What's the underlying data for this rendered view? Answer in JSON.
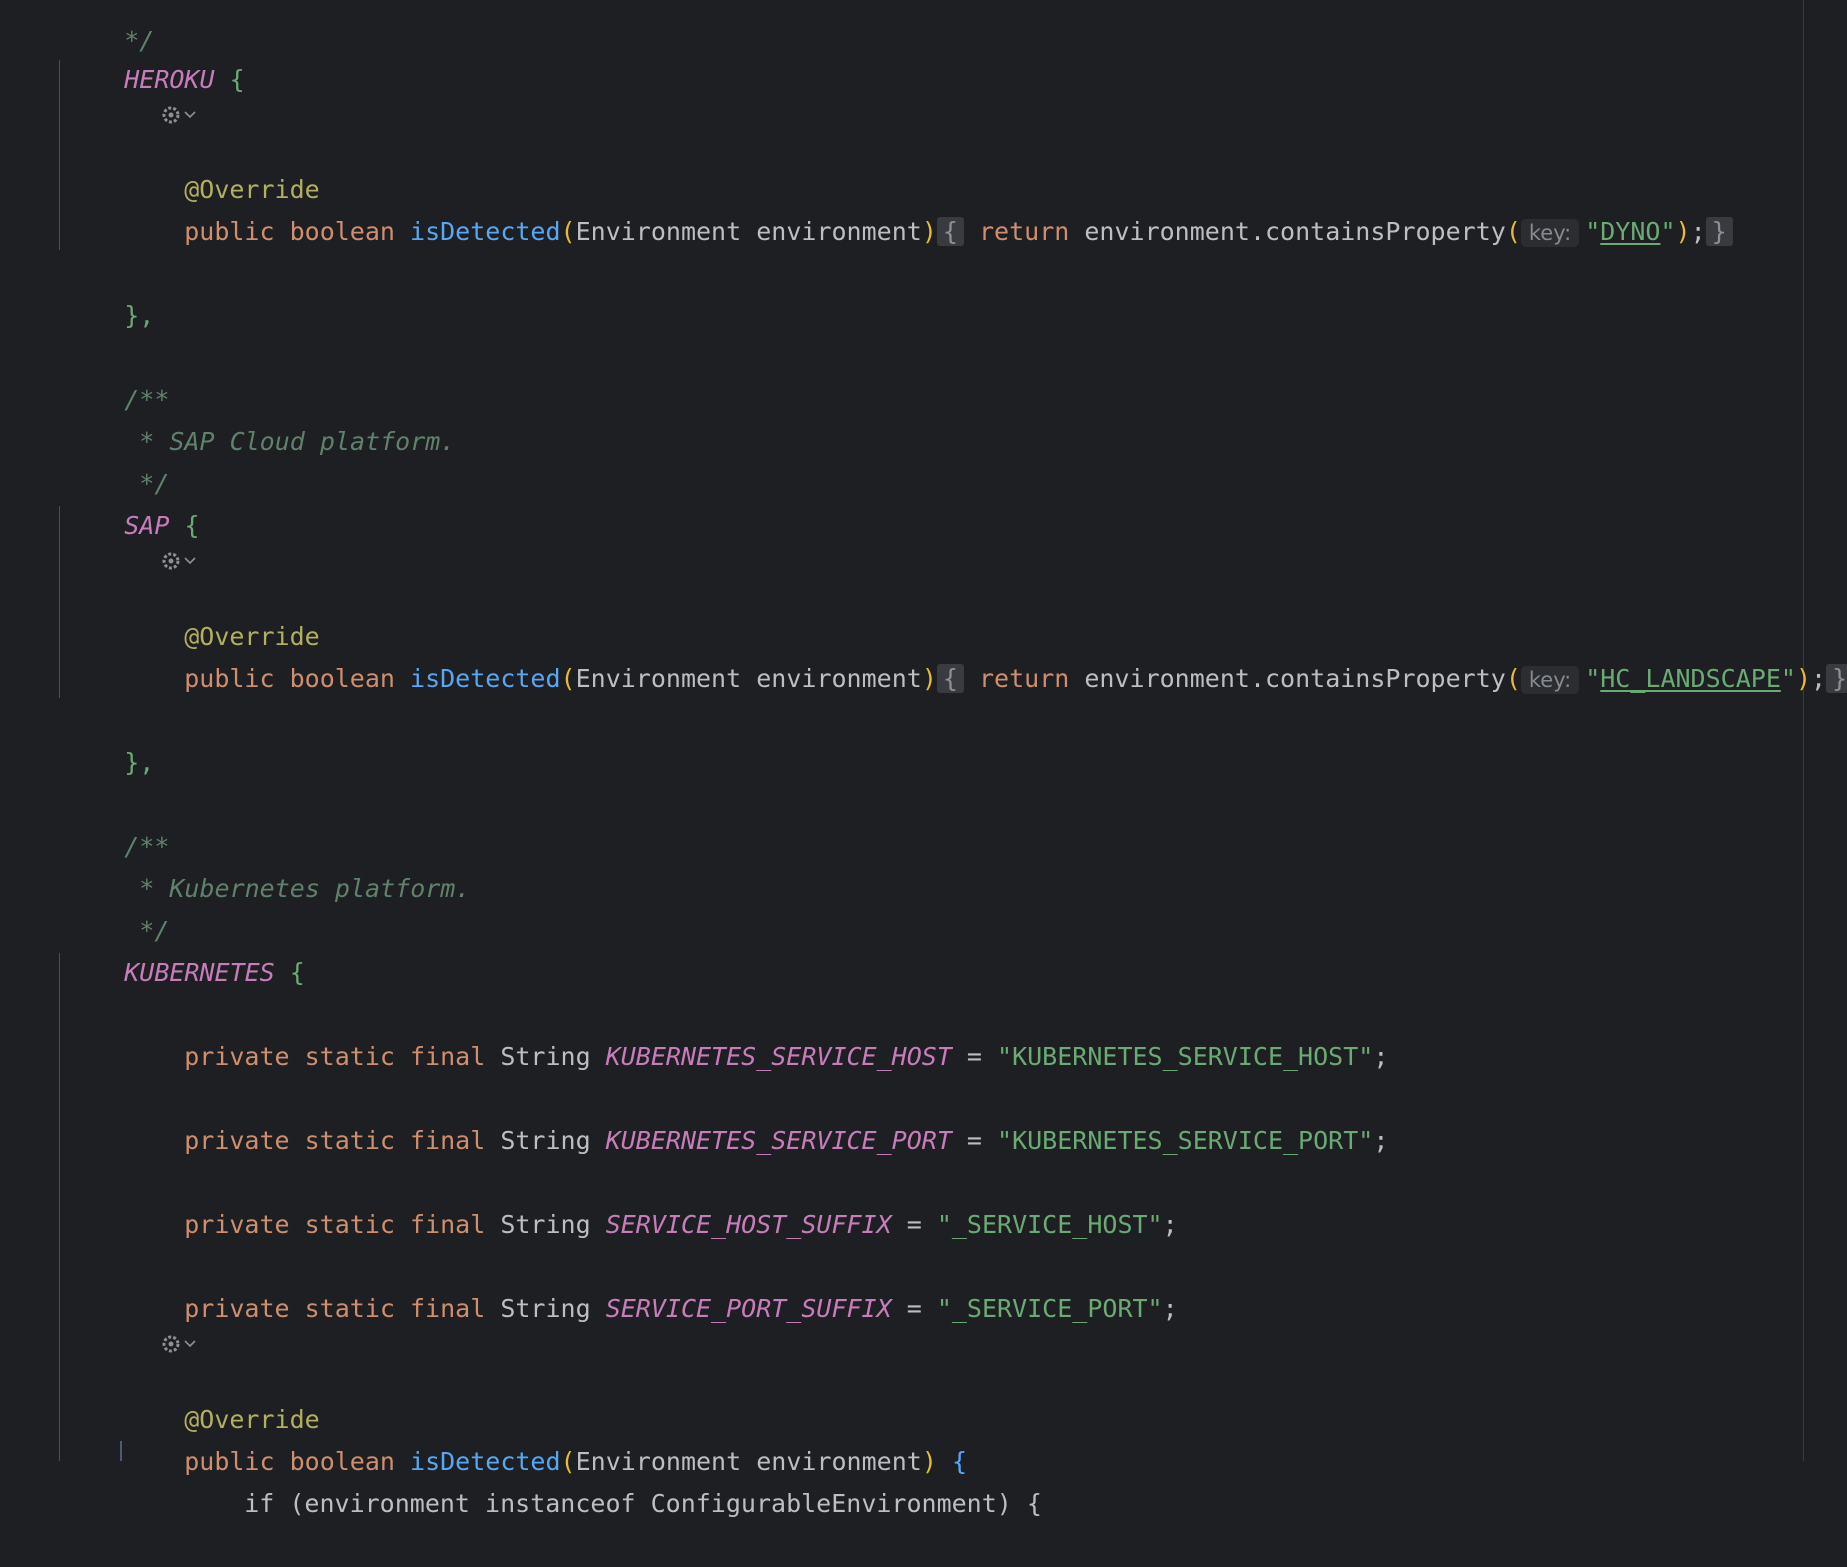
{
  "editor": {
    "heroku": {
      "name": "HEROKU",
      "annotation": "@Override",
      "method_kw_public": "public",
      "method_kw_boolean": "boolean",
      "method_name": "isDetected",
      "param_type": "Environment",
      "param_name": "environment",
      "return_kw": "return",
      "call": "environment.containsProperty",
      "hint_key": "key:",
      "arg_value": "DYNO"
    },
    "sap": {
      "doc_open": "/**",
      "doc_text": " * SAP Cloud platform.",
      "doc_close": " */",
      "name": "SAP",
      "annotation": "@Override",
      "method_kw_public": "public",
      "method_kw_boolean": "boolean",
      "method_name": "isDetected",
      "param_type": "Environment",
      "param_name": "environment",
      "return_kw": "return",
      "call": "environment.containsProperty",
      "hint_key": "key:",
      "arg_value": "HC_LANDSCAPE"
    },
    "kubernetes": {
      "doc_open": "/**",
      "doc_text": " * Kubernetes platform.",
      "doc_close": " */",
      "name": "KUBERNETES",
      "modifiers": "private static final",
      "type": "String",
      "fields": [
        {
          "name": "KUBERNETES_SERVICE_HOST",
          "value": "\"KUBERNETES_SERVICE_HOST\""
        },
        {
          "name": "KUBERNETES_SERVICE_PORT",
          "value": "\"KUBERNETES_SERVICE_PORT\""
        },
        {
          "name": "SERVICE_HOST_SUFFIX",
          "value": "\"_SERVICE_HOST\""
        },
        {
          "name": "SERVICE_PORT_SUFFIX",
          "value": "\"_SERVICE_PORT\""
        }
      ],
      "annotation": "@Override",
      "method_kw_public": "public",
      "method_kw_boolean": "boolean",
      "method_name": "isDetected",
      "param_type": "Environment",
      "param_name": "environment",
      "if_line": "if (environment instanceof ConfigurableEnvironment) {"
    },
    "closing": "},",
    "top_comment": "*/"
  },
  "icons": {
    "gear": "gear-icon",
    "chevron": "chevron-down-icon"
  }
}
